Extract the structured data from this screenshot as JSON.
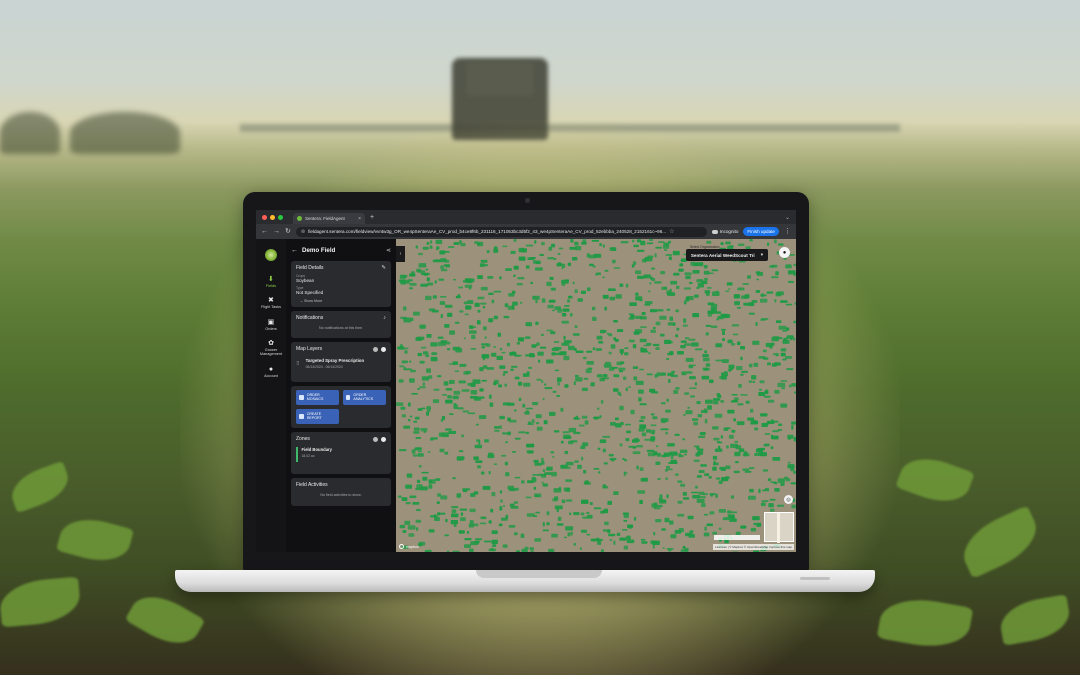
{
  "browser": {
    "tab_title": "Sentera: FieldAgent",
    "tab_close": "×",
    "new_tab": "+",
    "url": "fieldagent.sentera.com/fieldview/vvntw3g_OR_we4pSenteraAe_CV_prod_b4ce8f6b_231116_171053bc3d5f2_43_we4pSenteraAe_CV_prod_52ebbba_240528_2152161c~96...",
    "incognito_label": "Incognito",
    "finish_update_label": "Finish update",
    "colors": {
      "dot_red": "#ff5f57",
      "dot_yellow": "#febc2e",
      "dot_green": "#28c840",
      "accent": "#1a73e8"
    }
  },
  "rail": {
    "items": [
      {
        "label": "Fields",
        "icon": "download-icon",
        "glyph": "⬇",
        "active": true
      },
      {
        "label": "Flight Tasks",
        "icon": "drone-icon",
        "glyph": "✖",
        "active": false
      },
      {
        "label": "Orders",
        "icon": "clipboard-icon",
        "glyph": "▣",
        "active": false
      },
      {
        "label": "Grower Management",
        "icon": "paw-icon",
        "glyph": "✿",
        "active": false
      },
      {
        "label": "Account",
        "icon": "user-icon",
        "glyph": "●",
        "active": false
      }
    ],
    "accent": "#8fd14a"
  },
  "panel": {
    "title": "Demo Field",
    "field_details": {
      "title": "Field Details",
      "crop_label": "Crops",
      "crop_value": "Soybean",
      "type_label": "Type",
      "type_value": "Not Specified",
      "show_more": "Show More"
    },
    "notifications": {
      "title": "Notifications",
      "empty": "No notifications at this time."
    },
    "map_layers": {
      "title": "Map Layers",
      "layer_name": "Targeted Spray Prescription",
      "layer_dates": "06/14/2024 - 06/14/2024"
    },
    "actions": {
      "order_mosaics": "ORDER MOSAICS",
      "order_analytics": "ORDER ANALYTICS",
      "create_report": "CREATE REPORT",
      "button_color": "#3a63b8"
    },
    "zones": {
      "title": "Zones",
      "zone_name": "Field Boundary",
      "zone_area": "18.02 ac"
    },
    "field_activities": {
      "title": "Field Activities",
      "empty": "No field activities to show."
    }
  },
  "map": {
    "org_label": "Select Organization",
    "org_value": "Sentera Aerial WeedScout Tri",
    "attribution": "Licenses | © Mapbox © OpenStreetMap Improve this map",
    "mapbox": "mapbox",
    "weed_color": "#1e9a45",
    "soil_color": "#9c917a"
  }
}
